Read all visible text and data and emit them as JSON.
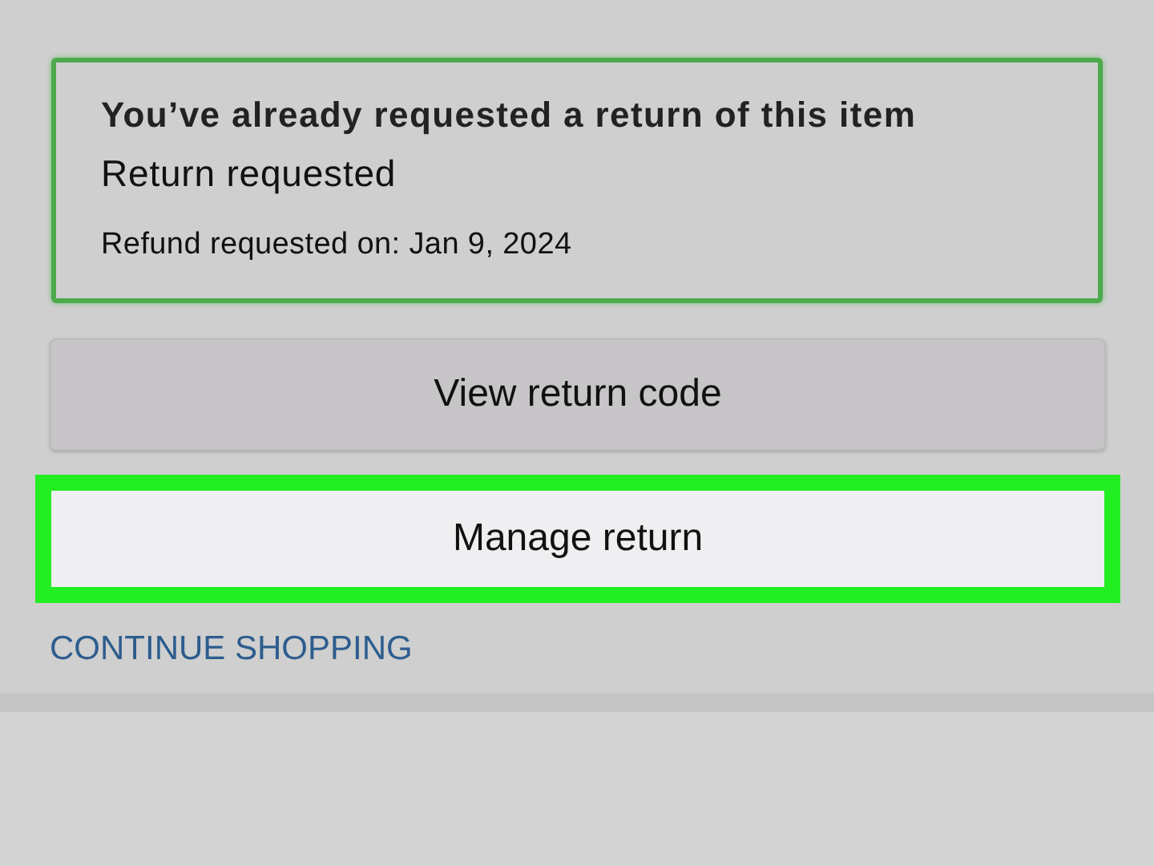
{
  "return_status": {
    "heading": "You’ve already requested a return of this item",
    "status": "Return requested",
    "refund_date": "Refund requested on: Jan 9, 2024"
  },
  "buttons": [
    {
      "label": "View return code",
      "highlighted": false
    },
    {
      "label": "Manage return",
      "highlighted": true
    }
  ],
  "link": "CONTINUE SHOPPING"
}
